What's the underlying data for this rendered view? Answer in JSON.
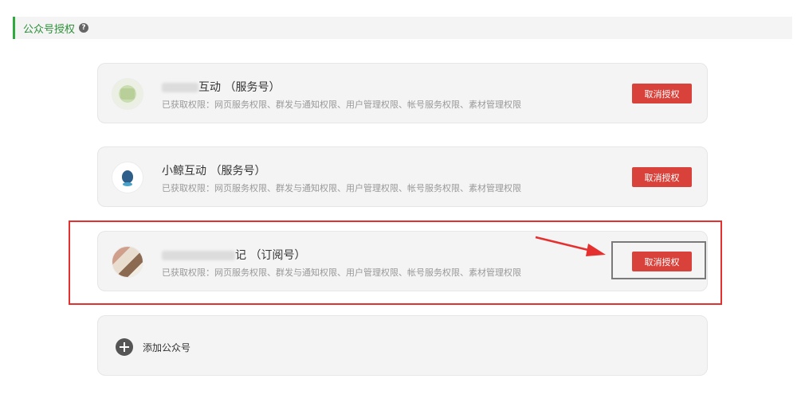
{
  "section": {
    "title": "公众号授权",
    "help_glyph": "?"
  },
  "accounts": [
    {
      "name": "互动",
      "type": "（服务号）",
      "permissions": "已获取权限：网页服务权限、群发与通知权限、用户管理权限、帐号服务权限、素材管理权限",
      "revoke_label": "取消授权"
    },
    {
      "name": "小鲸互动",
      "type": "（服务号）",
      "permissions": "已获取权限：网页服务权限、群发与通知权限、用户管理权限、帐号服务权限、素材管理权限",
      "revoke_label": "取消授权"
    },
    {
      "name": "记",
      "type": "（订阅号）",
      "permissions": "已获取权限：网页服务权限、群发与通知权限、用户管理权限、帐号服务权限、素材管理权限",
      "revoke_label": "取消授权"
    }
  ],
  "add": {
    "label": "添加公众号"
  },
  "colors": {
    "accent_green": "#2eaa3c",
    "revoke_red": "#d8423b",
    "annotation_red": "#e53030"
  },
  "icons": {
    "help": "help-icon",
    "add": "plus-circle-icon"
  }
}
